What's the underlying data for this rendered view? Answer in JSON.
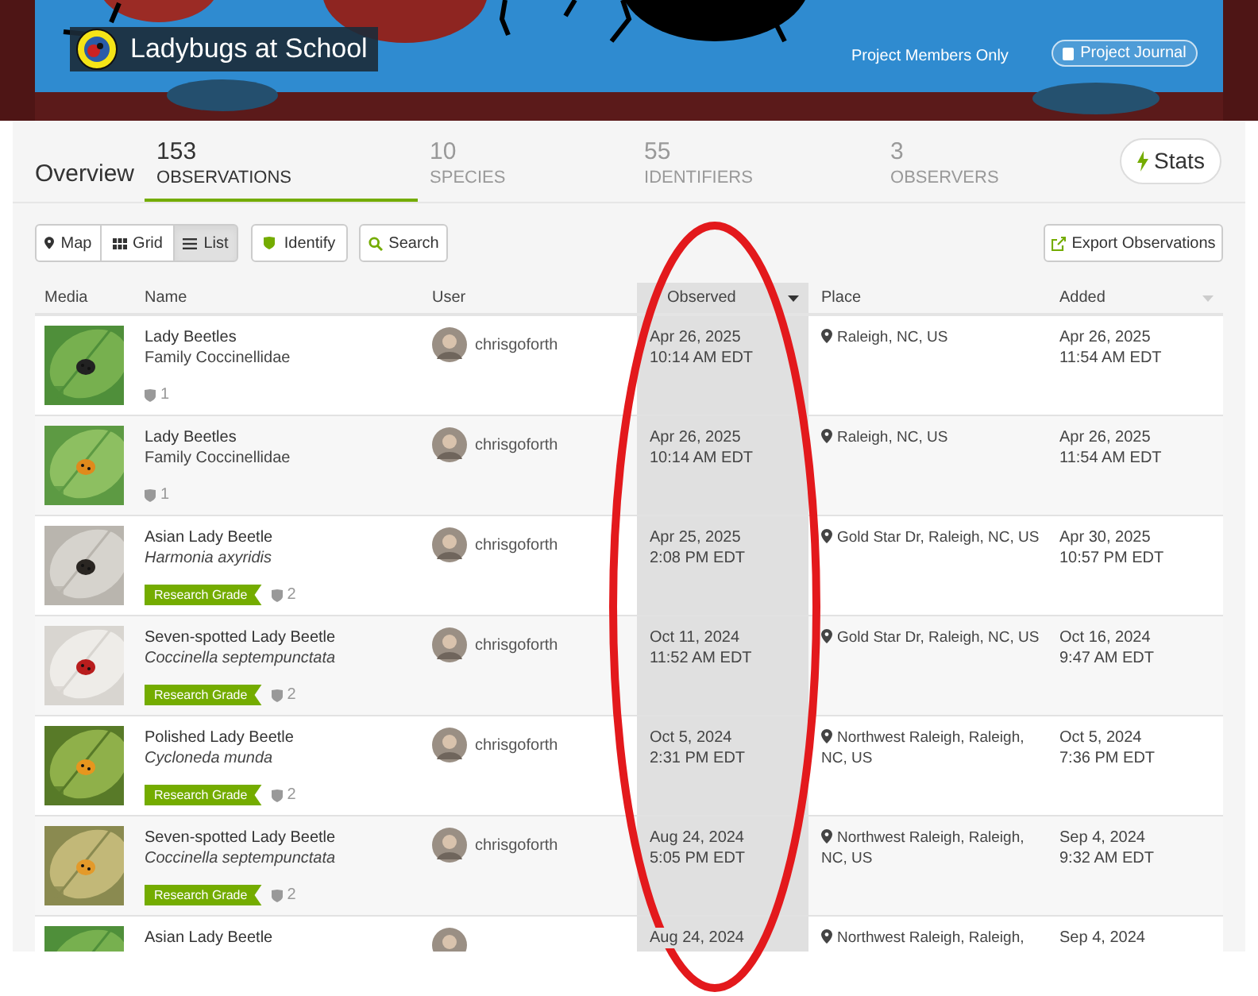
{
  "project": {
    "title": "Ladybugs at School",
    "membership_note": "Project Members Only",
    "journal_button": "Project Journal"
  },
  "tabs": [
    {
      "kind": "plain",
      "label": "Overview",
      "selected": false
    },
    {
      "kind": "count",
      "count": "153",
      "label": "OBSERVATIONS",
      "selected": true
    },
    {
      "kind": "count",
      "count": "10",
      "label": "SPECIES",
      "selected": false
    },
    {
      "kind": "count",
      "count": "55",
      "label": "IDENTIFIERS",
      "selected": false
    },
    {
      "kind": "count",
      "count": "3",
      "label": "OBSERVERS",
      "selected": false
    }
  ],
  "stats_button": "Stats",
  "view_buttons": [
    {
      "kind": "map",
      "label": "Map",
      "selected": false
    },
    {
      "kind": "grid",
      "label": "Grid",
      "selected": false
    },
    {
      "kind": "list",
      "label": "List",
      "selected": true
    }
  ],
  "identify_button": "Identify",
  "search_button": "Search",
  "export_button": "Export Observations",
  "table": {
    "columns": [
      {
        "label": "Media",
        "sorted": false,
        "sort_icon": false
      },
      {
        "label": "Name",
        "sorted": false,
        "sort_icon": false
      },
      {
        "label": "User",
        "sorted": false,
        "sort_icon": false
      },
      {
        "label": "Observed",
        "sorted": true,
        "sort_icon": true
      },
      {
        "label": "Place",
        "sorted": false,
        "sort_icon": false
      },
      {
        "label": "Added",
        "sorted": false,
        "sort_icon": true
      }
    ],
    "rows": [
      {
        "name": "Lady Beetles",
        "taxon": "Family Coccinellidae",
        "kind": "family",
        "ids": "1",
        "user": "chrisgoforth",
        "observed": [
          "Apr 26, 2025",
          "10:14 AM EDT"
        ],
        "place": "Raleigh, NC, US",
        "added": [
          "Apr 26, 2025",
          "11:54 AM EDT"
        ]
      },
      {
        "name": "Lady Beetles",
        "taxon": "Family Coccinellidae",
        "kind": "family",
        "ids": "1",
        "user": "chrisgoforth",
        "observed": [
          "Apr 26, 2025",
          "10:14 AM EDT"
        ],
        "place": "Raleigh, NC, US",
        "added": [
          "Apr 26, 2025",
          "11:54 AM EDT"
        ]
      },
      {
        "name": "Asian Lady Beetle",
        "taxon": "Harmonia axyridis",
        "kind": "species",
        "quality": "Research Grade",
        "ids": "2",
        "user": "chrisgoforth",
        "observed": [
          "Apr 25, 2025",
          "2:08 PM EDT"
        ],
        "place": "Gold Star Dr, Raleigh, NC, US",
        "added": [
          "Apr 30, 2025",
          "10:57 PM EDT"
        ]
      },
      {
        "name": "Seven-spotted Lady Beetle",
        "taxon": "Coccinella septempunctata",
        "kind": "species",
        "quality": "Research Grade",
        "ids": "2",
        "user": "chrisgoforth",
        "observed": [
          "Oct 11, 2024",
          "11:52 AM EDT"
        ],
        "place": "Gold Star Dr, Raleigh, NC, US",
        "added": [
          "Oct 16, 2024",
          "9:47 AM EDT"
        ]
      },
      {
        "name": "Polished Lady Beetle",
        "taxon": "Cycloneda munda",
        "kind": "species",
        "quality": "Research Grade",
        "ids": "2",
        "user": "chrisgoforth",
        "observed": [
          "Oct 5, 2024",
          "2:31 PM EDT"
        ],
        "place": "Northwest Raleigh, Raleigh, NC, US",
        "added": [
          "Oct 5, 2024",
          "7:36 PM EDT"
        ]
      },
      {
        "name": "Seven-spotted Lady Beetle",
        "taxon": "Coccinella septempunctata",
        "kind": "species",
        "quality": "Research Grade",
        "ids": "2",
        "user": "chrisgoforth",
        "observed": [
          "Aug 24, 2024",
          "5:05 PM EDT"
        ],
        "place": "Northwest Raleigh, Raleigh, NC, US",
        "added": [
          "Sep 4, 2024",
          "9:32 AM EDT"
        ]
      },
      {
        "name": "Asian Lady Beetle",
        "observed": [
          "Aug 24, 2024"
        ],
        "place": "Northwest Raleigh, Raleigh,",
        "added": [
          "Sep 4, 2024"
        ]
      }
    ]
  }
}
